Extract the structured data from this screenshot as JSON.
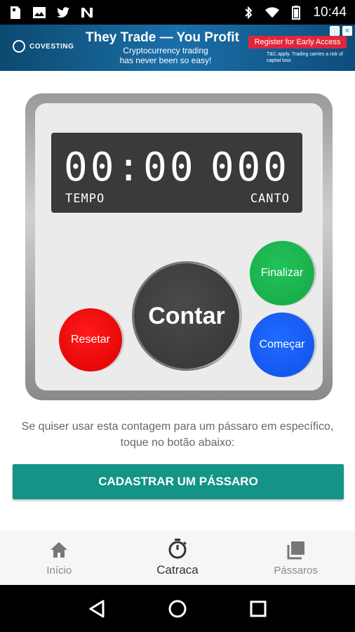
{
  "status_bar": {
    "time": "10:44",
    "icons_left": [
      "sim-icon",
      "image-icon",
      "twitter-icon",
      "n-icon"
    ],
    "icons_right": [
      "bluetooth-icon",
      "wifi-icon",
      "battery-icon"
    ]
  },
  "ad": {
    "brand": "COVESTING",
    "title": "They Trade — You Profit",
    "subtitle": "Cryptocurrency trading has never been so easy!",
    "cta": "Register for Early Access",
    "fine_print": "T&C apply. Trading carries a risk of capital loss"
  },
  "counter": {
    "time_value": "00:00",
    "count_value": "000",
    "time_label": "TEMPO",
    "count_label": "CANTO"
  },
  "buttons": {
    "contar": "Contar",
    "resetar": "Resetar",
    "finalizar": "Finalizar",
    "comecar": "Começar"
  },
  "hint": "Se quiser usar esta contagem para um pássaro em específico, toque no botão abaixo:",
  "cta": "CADASTRAR UM PÁSSARO",
  "nav": {
    "items": [
      {
        "label": "Início",
        "icon": "home-icon",
        "active": false
      },
      {
        "label": "Catraca",
        "icon": "stopwatch-icon",
        "active": true
      },
      {
        "label": "Pássaros",
        "icon": "library-icon",
        "active": false
      }
    ]
  },
  "colors": {
    "accent": "#139486",
    "reset": "#e00000",
    "finish": "#18b04c",
    "start": "#1558f0",
    "count": "#3d3d3d"
  }
}
